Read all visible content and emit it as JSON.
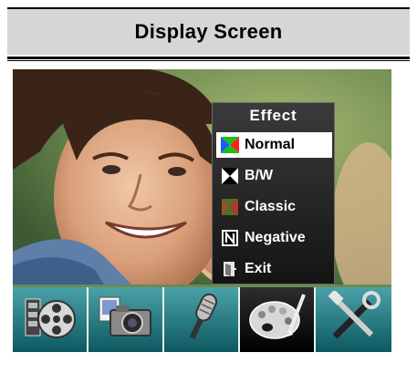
{
  "header": {
    "title": "Display Screen"
  },
  "menu": {
    "title": "Effect",
    "items": [
      {
        "label": "Normal",
        "icon": "rgb-quad-icon",
        "selected": true
      },
      {
        "label": "B/W",
        "icon": "bw-icon",
        "selected": false
      },
      {
        "label": "Classic",
        "icon": "classic-icon",
        "selected": false
      },
      {
        "label": "Negative",
        "icon": "negative-n-icon",
        "selected": false
      },
      {
        "label": "Exit",
        "icon": "exit-door-icon",
        "selected": false
      }
    ]
  },
  "toolbar": {
    "items": [
      {
        "name": "film-reel",
        "icon": "film-reel-icon"
      },
      {
        "name": "camera",
        "icon": "camera-icon"
      },
      {
        "name": "microphone",
        "icon": "microphone-icon"
      },
      {
        "name": "effect-palette",
        "icon": "palette-icon",
        "active": true
      },
      {
        "name": "settings-tools",
        "icon": "tools-icon"
      }
    ]
  },
  "colors": {
    "menu_bg": "#1e1e1e",
    "toolbar_teal": "#3f9aa0",
    "active_tool": "#000000"
  }
}
